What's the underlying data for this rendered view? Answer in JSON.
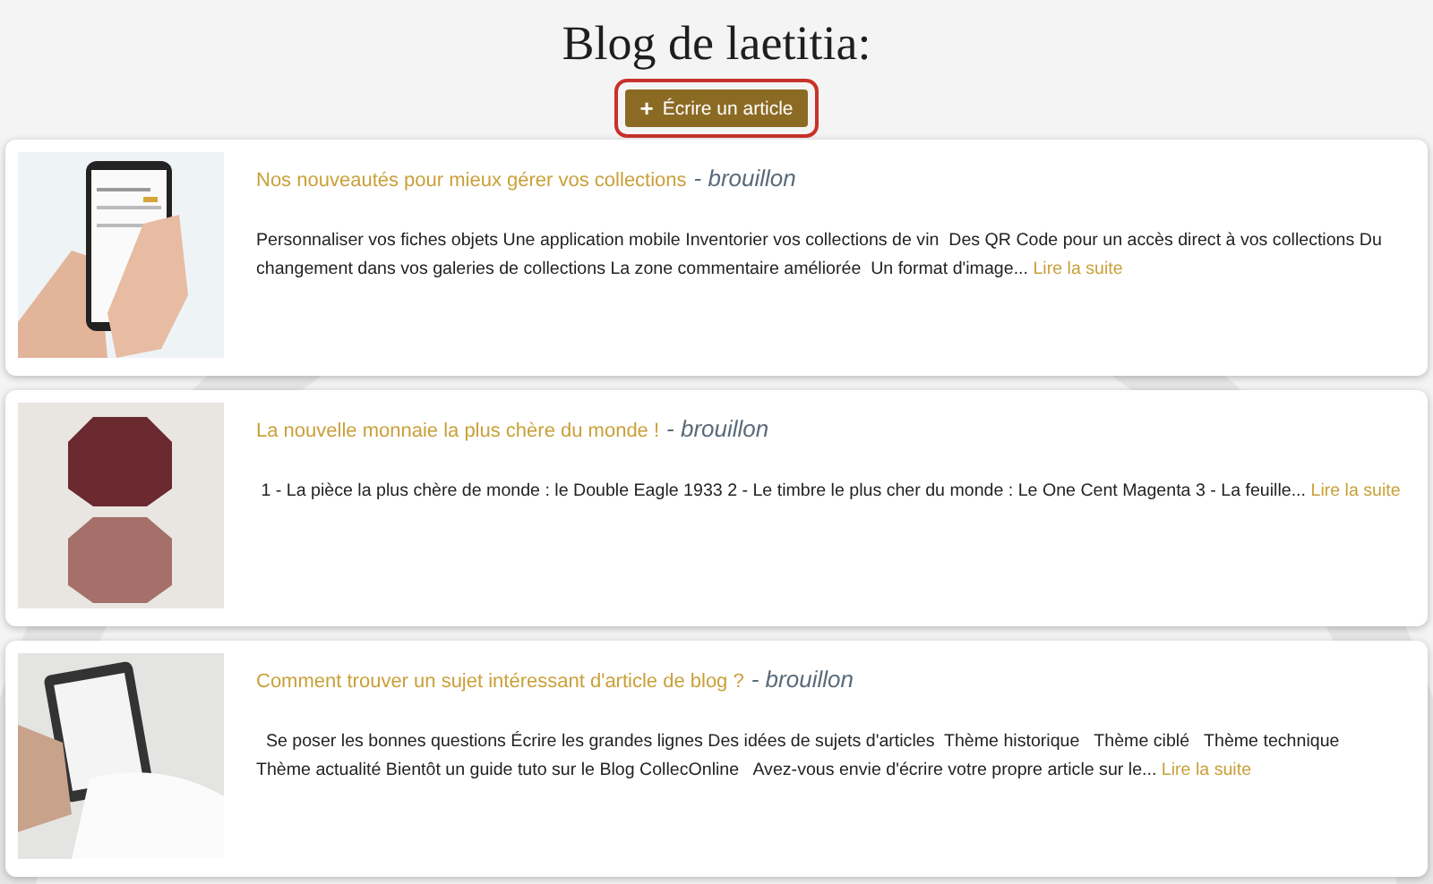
{
  "page_title": "Blog de laetitia:",
  "write_button": {
    "icon": "+",
    "label": "Écrire un article",
    "highlighted": true
  },
  "posts": [
    {
      "title": "Nos nouveautés pour mieux gérer vos collections",
      "status": "- brouillon",
      "excerpt": "Personnaliser vos fiches objets Une application mobile Inventorier vos collections de vin  Des QR Code pour un accès direct à vos collections Du changement dans vos galeries de collections La zone commentaire améliorée  Un format d'image...",
      "read_more": "Lire la suite",
      "kind": "phone"
    },
    {
      "title": "La nouvelle monnaie la plus chère du monde !",
      "status": "- brouillon",
      "excerpt": " 1 - La pièce la plus chère de monde : le Double Eagle 1933 2 - Le timbre le plus cher du monde : Le One Cent Magenta 3 - La feuille...",
      "read_more": "Lire la suite",
      "kind": "coins"
    },
    {
      "title": "Comment trouver un sujet intéressant d'article de blog ?",
      "status": "- brouillon",
      "excerpt": "  Se poser les bonnes questions Écrire les grandes lignes Des idées de sujets d'articles  Thème historique   Thème ciblé   Thème technique   Thème actualité Bientôt un guide tuto sur le Blog CollecOnline   Avez-vous envie d'écrire votre propre article sur le...",
      "read_more": "Lire la suite",
      "kind": "tablet"
    }
  ]
}
